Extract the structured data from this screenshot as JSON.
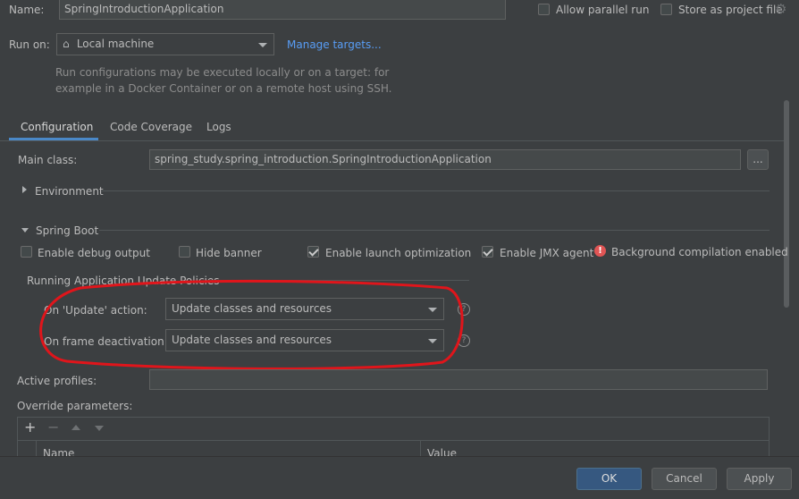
{
  "header": {
    "name_label": "Name:",
    "name_value": "SpringIntroductionApplication",
    "allow_parallel_run": "Allow parallel run",
    "store_as_project_file": "Store as project file"
  },
  "run_on": {
    "label": "Run on:",
    "target": "Local machine",
    "manage_targets": "Manage targets...",
    "hint_line1": "Run configurations may be executed locally or on a target: for",
    "hint_line2": "example in a Docker Container or on a remote host using SSH."
  },
  "tabs": [
    {
      "label": "Configuration",
      "active": true
    },
    {
      "label": "Code Coverage",
      "active": false
    },
    {
      "label": "Logs",
      "active": false
    }
  ],
  "config": {
    "main_class_label": "Main class:",
    "main_class_value": "spring_study.spring_introduction.SpringIntroductionApplication",
    "browse_label": "...",
    "environment_label": "Environment",
    "spring_boot_label": "Spring Boot",
    "options": {
      "debug_output": {
        "label": "Enable debug output",
        "checked": false
      },
      "hide_banner": {
        "label": "Hide banner",
        "checked": false
      },
      "launch_optimization": {
        "label": "Enable launch optimization",
        "checked": true
      },
      "jmx_agent": {
        "label": "Enable JMX agent",
        "checked": true
      }
    },
    "background_compilation": "Background compilation enabled",
    "update_policies_title": "Running Application Update Policies",
    "on_update_label": "On 'Update' action:",
    "on_update_value": "Update classes and resources",
    "on_frame_label": "On frame deactivation:",
    "on_frame_value": "Update classes and resources",
    "active_profiles_label": "Active profiles:",
    "active_profiles_value": "",
    "override_parameters_label": "Override parameters:",
    "table_columns": [
      "Name",
      "Value"
    ]
  },
  "buttons": {
    "ok": "OK",
    "cancel": "Cancel",
    "apply": "Apply"
  },
  "colors": {
    "background": "#3c3f41",
    "accent": "#4a88c7",
    "annotation_circle": "#e0151b",
    "error_icon": "#e05555"
  }
}
